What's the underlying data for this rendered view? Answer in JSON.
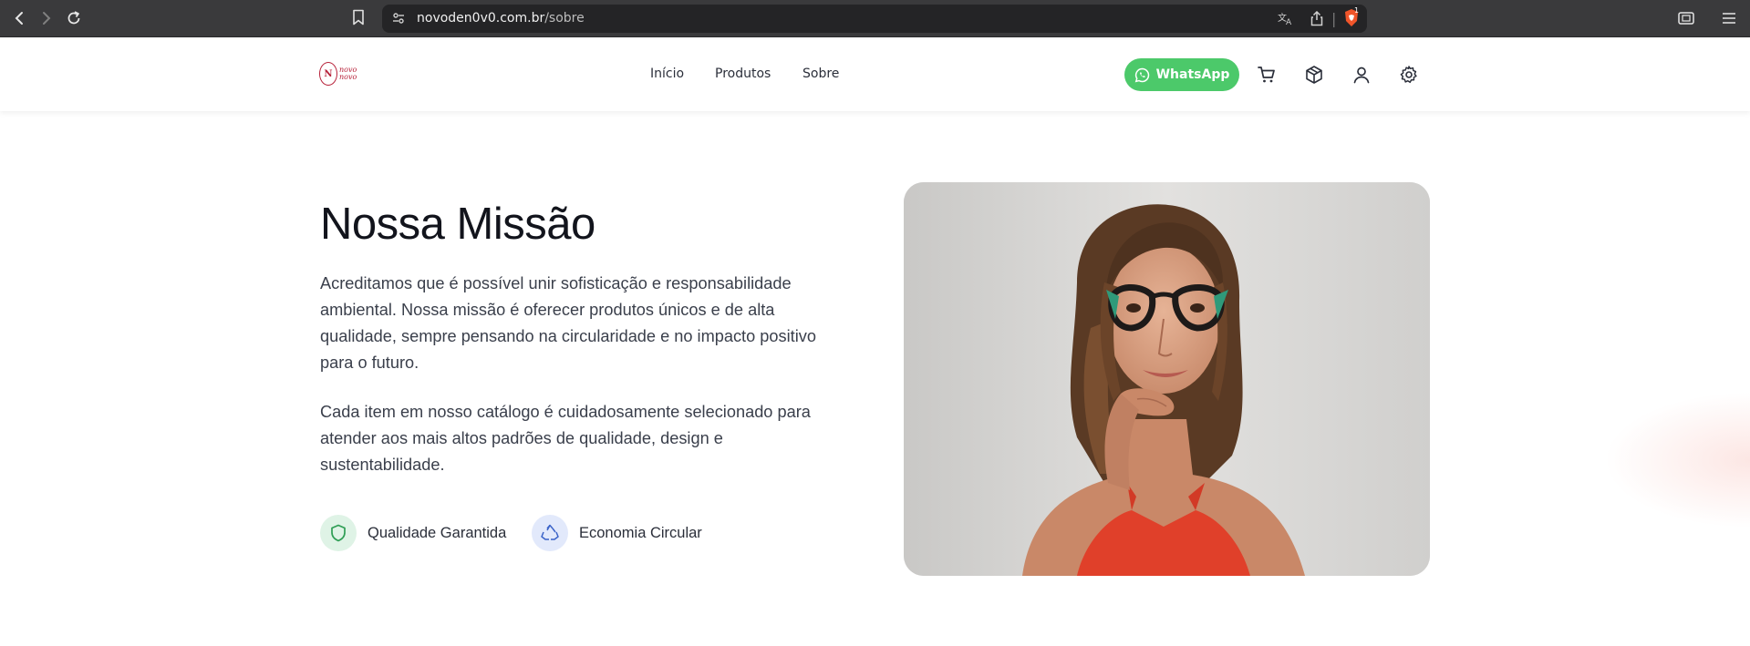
{
  "browser": {
    "url_host": "novoden0v0.com.br",
    "url_path": "/sobre",
    "brave_badge": "1"
  },
  "header": {
    "logo_mark": "N",
    "logo_line1": "novo",
    "logo_line2": "novo",
    "nav": [
      {
        "label": "Início"
      },
      {
        "label": "Produtos"
      },
      {
        "label": "Sobre"
      }
    ],
    "whatsapp_label": "WhatsApp",
    "colors": {
      "whatsapp": "#4cc96a",
      "brand": "#b7223a"
    },
    "icons": [
      "cart-icon",
      "box-icon",
      "user-icon",
      "settings-icon"
    ]
  },
  "mission": {
    "title": "Nossa Missão",
    "paragraph1": "Acreditamos que é possível unir sofisticação e responsabilidade ambiental. Nossa missão é oferecer produtos únicos e de alta qualidade, sempre pensando na circularidade e no impacto positivo para o futuro.",
    "paragraph2": "Cada item em nosso catálogo é cuidadosamente selecionado para atender aos mais altos padrões de qualidade, design e sustentabilidade.",
    "features": [
      {
        "label": "Qualidade Garantida",
        "icon": "shield-icon",
        "color": "#2f9e55",
        "bg": "#dff3e6"
      },
      {
        "label": "Economia Circular",
        "icon": "recycle-icon",
        "color": "#3b63c8",
        "bg": "#e2e9fb"
      }
    ]
  }
}
